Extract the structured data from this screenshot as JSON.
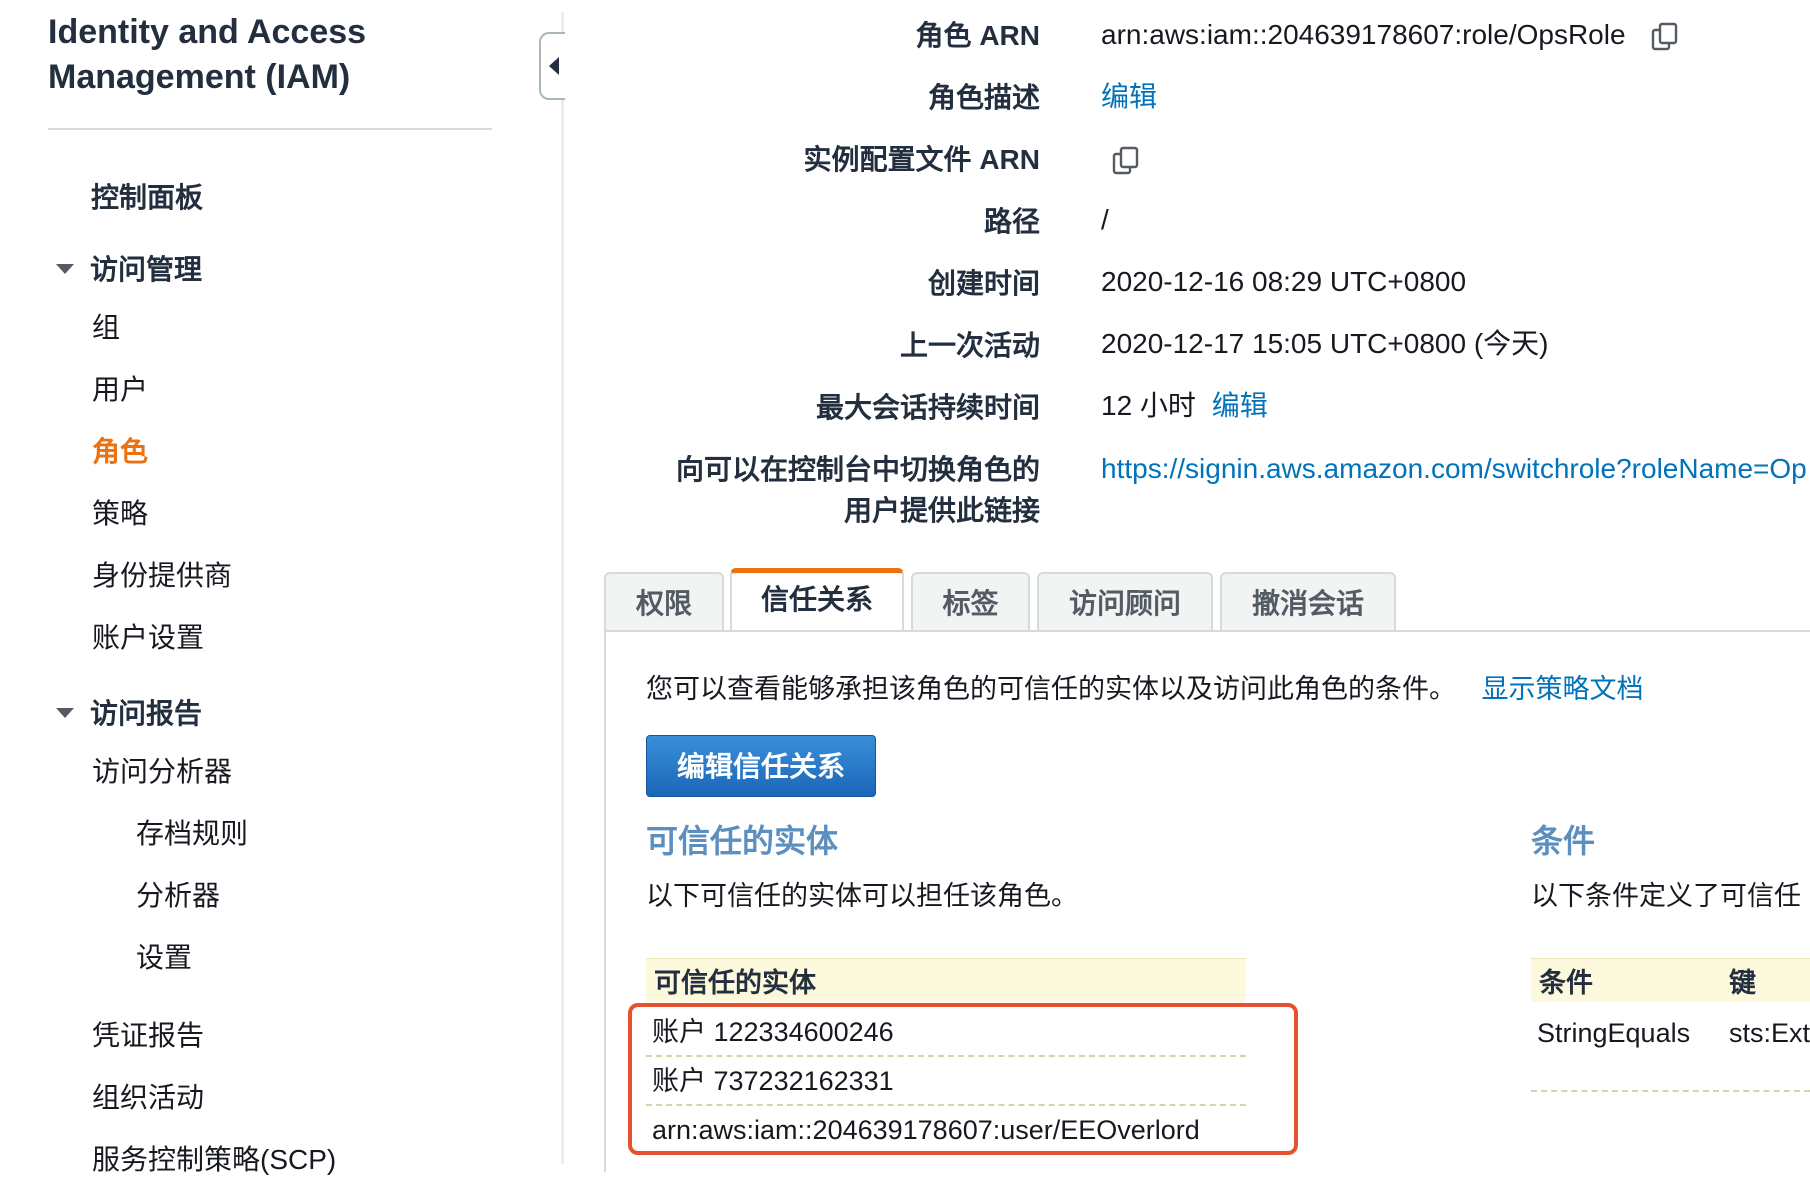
{
  "sidebar": {
    "title": "Identity and Access Management (IAM)",
    "dashboard": "控制面板",
    "access_management": {
      "label": "访问管理",
      "items": [
        "组",
        "用户",
        "角色",
        "策略",
        "身份提供商",
        "账户设置"
      ]
    },
    "access_reports": {
      "label": "访问报告",
      "analyzer": "访问分析器",
      "analyzer_items": [
        "存档规则",
        "分析器",
        "设置"
      ],
      "items": [
        "凭证报告",
        "组织活动",
        "服务控制策略(SCP)"
      ]
    }
  },
  "summary": {
    "role_arn_label": "角色 ARN",
    "role_arn": "arn:aws:iam::204639178607:role/OpsRole",
    "role_desc_label": "角色描述",
    "role_desc_link": "编辑",
    "instance_profile_label": "实例配置文件 ARN",
    "path_label": "路径",
    "path": "/",
    "created_label": "创建时间",
    "created": "2020-12-16 08:29 UTC+0800",
    "last_activity_label": "上一次活动",
    "last_activity": "2020-12-17 15:05 UTC+0800 (今天)",
    "max_session_label": "最大会话持续时间",
    "max_session": "12 小时",
    "max_session_link": "编辑",
    "switch_link_label_1": "向可以在控制台中切换角色的",
    "switch_link_label_2": "用户提供此链接",
    "switch_link": "https://signin.aws.amazon.com/switchrole?roleName=Op"
  },
  "tabs": [
    "权限",
    "信任关系",
    "标签",
    "访问顾问",
    "撤消会话"
  ],
  "trust": {
    "intro": "您可以查看能够承担该角色的可信任的实体以及访问此角色的条件。",
    "show_doc_link": "显示策略文档",
    "edit_button": "编辑信任关系",
    "entities_title": "可信任的实体",
    "entities_desc": "以下可信任的实体可以担任该角色。",
    "entities_header": "可信任的实体",
    "entities": [
      "账户 122334600246",
      "账户 737232162331",
      "arn:aws:iam::204639178607:user/EEOverlord"
    ],
    "conditions_title": "条件",
    "conditions_desc": "以下条件定义了可信任",
    "conditions_headers": [
      "条件",
      "键"
    ],
    "conditions_row": [
      "StringEquals",
      "sts:Ext"
    ]
  },
  "colors": {
    "accent_orange": "#ec7211",
    "link_blue": "#0073bb",
    "highlight_red": "#e4532d"
  }
}
